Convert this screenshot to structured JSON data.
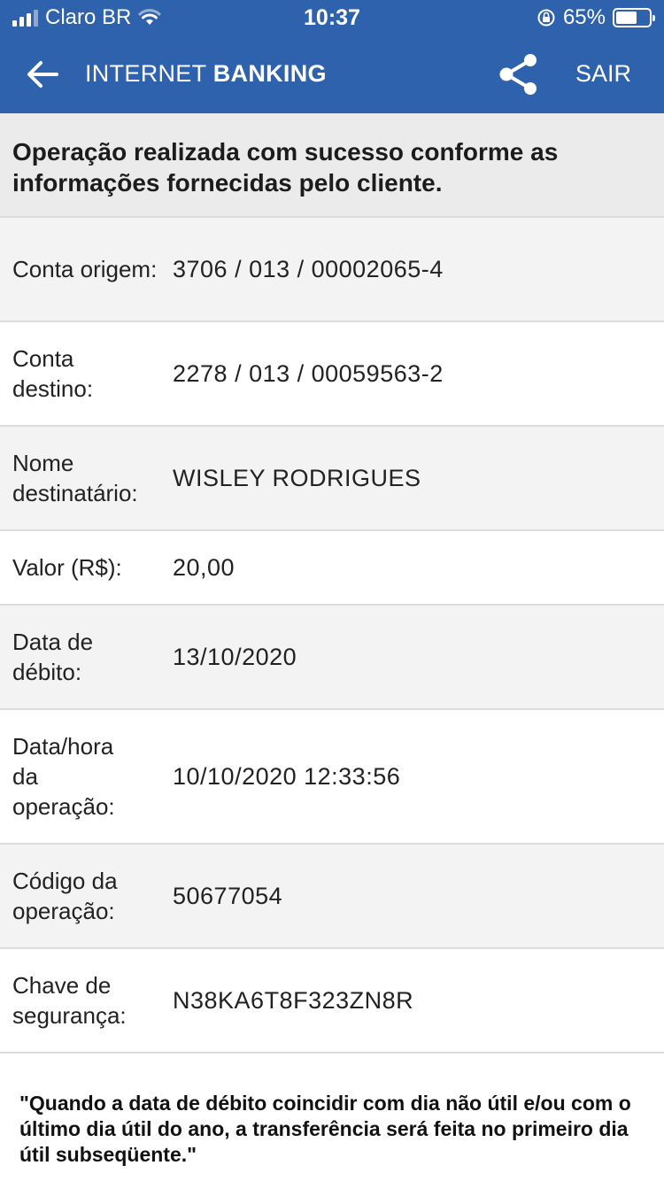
{
  "status_bar": {
    "carrier": "Claro BR",
    "time": "10:37",
    "battery_percent": "65%",
    "battery_level": 0.65,
    "signal_icon": "cellular-signal-icon",
    "wifi_icon": "wifi-icon",
    "lock_icon": "orientation-lock-icon"
  },
  "header": {
    "title_regular": "INTERNET",
    "title_bold": "BANKING",
    "back_icon": "arrow-left-icon",
    "share_icon": "share-icon",
    "exit_label": "SAIR"
  },
  "success_message": "Operação realizada com sucesso conforme as informações fornecidas pelo cliente.",
  "details": [
    {
      "label": "Conta origem:",
      "value": "3706 / 013 / 00002065-4"
    },
    {
      "label": "Conta destino:",
      "value": "2278 / 013 / 00059563-2"
    },
    {
      "label": "Nome destinatário:",
      "value": "WISLEY RODRIGUES"
    },
    {
      "label": "Valor (R$):",
      "value": "20,00"
    },
    {
      "label": "Data de débito:",
      "value": "13/10/2020"
    },
    {
      "label": "Data/hora da operação:",
      "value": "10/10/2020 12:33:56"
    },
    {
      "label": "Código da operação:",
      "value": "50677054"
    },
    {
      "label": "Chave de segurança:",
      "value": "N38KA6T8F323ZN8R"
    }
  ],
  "footnote": "\"Quando a data de débito coincidir com dia não útil e/ou com o último dia útil do ano, a transferência será feita no primeiro dia útil subseqüente.\"",
  "colors": {
    "brand_blue": "#2f62ad",
    "row_gray": "#f3f3f3",
    "banner_gray": "#ebebeb"
  }
}
